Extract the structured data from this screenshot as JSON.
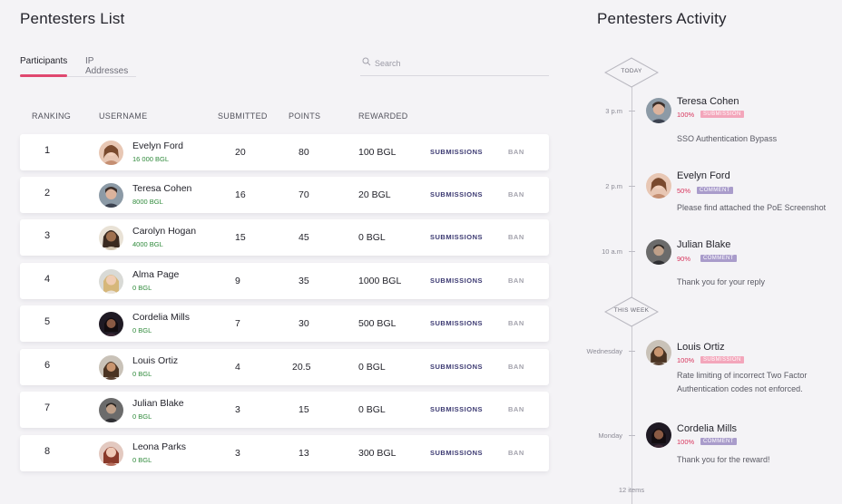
{
  "list": {
    "title": "Pentesters List",
    "tabs": [
      {
        "label": "Participants",
        "active": true
      },
      {
        "label": "IP Addresses",
        "active": false
      }
    ],
    "search": {
      "placeholder": "Search",
      "value": ""
    },
    "headers": {
      "ranking": "RANKING",
      "username": "USERNAME",
      "submitted": "SUBMITTED",
      "points": "POINTS",
      "rewarded": "REWARDED"
    },
    "rows": [
      {
        "rank": "1",
        "name": "Evelyn Ford",
        "balance": "16 000 BGL",
        "submitted": "20",
        "points": "80",
        "rewarded": "100 BGL",
        "submissions_label": "SUBMISSIONS",
        "ban_label": "BAN"
      },
      {
        "rank": "2",
        "name": "Teresa Cohen",
        "balance": "8000 BGL",
        "submitted": "16",
        "points": "70",
        "rewarded": "20 BGL",
        "submissions_label": "SUBMISSIONS",
        "ban_label": "BAN"
      },
      {
        "rank": "3",
        "name": "Carolyn Hogan",
        "balance": "4000 BGL",
        "submitted": "15",
        "points": "45",
        "rewarded": "0 BGL",
        "submissions_label": "SUBMISSIONS",
        "ban_label": "BAN"
      },
      {
        "rank": "4",
        "name": "Alma Page",
        "balance": "0 BGL",
        "submitted": "9",
        "points": "35",
        "rewarded": "1000 BGL",
        "submissions_label": "SUBMISSIONS",
        "ban_label": "BAN"
      },
      {
        "rank": "5",
        "name": "Cordelia Mills",
        "balance": "0 BGL",
        "submitted": "7",
        "points": "30",
        "rewarded": "500 BGL",
        "submissions_label": "SUBMISSIONS",
        "ban_label": "BAN"
      },
      {
        "rank": "6",
        "name": "Louis Ortiz",
        "balance": "0 BGL",
        "submitted": "4",
        "points": "20.5",
        "rewarded": "0 BGL",
        "submissions_label": "SUBMISSIONS",
        "ban_label": "BAN"
      },
      {
        "rank": "7",
        "name": "Julian Blake",
        "balance": "0 BGL",
        "submitted": "3",
        "points": "15",
        "rewarded": "0 BGL",
        "submissions_label": "SUBMISSIONS",
        "ban_label": "BAN"
      },
      {
        "rank": "8",
        "name": "Leona Parks",
        "balance": "0 BGL",
        "submitted": "3",
        "points": "13",
        "rewarded": "300 BGL",
        "submissions_label": "SUBMISSIONS",
        "ban_label": "BAN"
      }
    ]
  },
  "activity": {
    "title": "Pentesters Activity",
    "markers": {
      "today": "TODAY",
      "this_week": "THIS WEEK"
    },
    "entries": [
      {
        "time": "3 p.m",
        "name": "Teresa Cohen",
        "percent": "100%",
        "badge": "SUBMISSION",
        "text": "SSO Authentication Bypass"
      },
      {
        "time": "2 p.m",
        "name": "Evelyn Ford",
        "percent": "50%",
        "badge": "COMMENT",
        "text": "Please find attached the PoE Screenshot"
      },
      {
        "time": "10 a.m",
        "name": "Julian Blake",
        "percent": "90%",
        "badge": "COMMENT",
        "text": "Thank you for your reply"
      },
      {
        "time": "Wednesday",
        "name": "Louis Ortiz",
        "percent": "100%",
        "badge": "SUBMISSION",
        "text": "Rate limiting of incorrect Two Factor Authentication codes not enforced."
      },
      {
        "time": "Monday",
        "name": "Cordelia Mills",
        "percent": "100%",
        "badge": "COMMENT",
        "text": "Thank you for the reward!"
      }
    ],
    "items_count": "12 items"
  },
  "colors": {
    "accent": "#e0486f",
    "balance_green": "#2f8a3b",
    "submissions_link": "#3c3a72",
    "percent_pink": "#d8345c",
    "badge_submission": "#f3a6bb",
    "badge_comment": "#a99ccb"
  }
}
